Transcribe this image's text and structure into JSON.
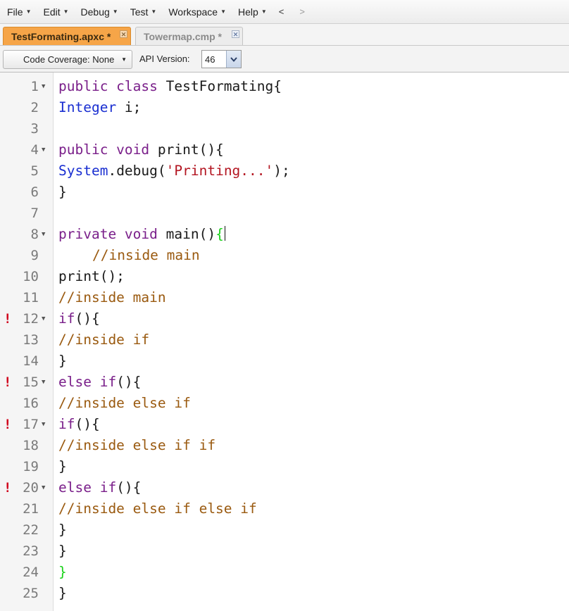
{
  "menubar": {
    "items": [
      {
        "label": "File"
      },
      {
        "label": "Edit"
      },
      {
        "label": "Debug"
      },
      {
        "label": "Test"
      },
      {
        "label": "Workspace"
      },
      {
        "label": "Help"
      }
    ],
    "back_label": "<",
    "forward_label": ">"
  },
  "tabs": [
    {
      "label": "TestFormating.apxc *",
      "active": true
    },
    {
      "label": "Towermap.cmp *",
      "active": false
    }
  ],
  "toolbar": {
    "coverage_label": "Code Coverage: None",
    "api_label": "API Version:",
    "api_value": "46"
  },
  "editor": {
    "lines": [
      {
        "num": "1",
        "fold": true,
        "error": false,
        "tokens": [
          {
            "t": "public class",
            "c": "kw"
          },
          {
            "t": " TestFormating{",
            "c": "plain"
          }
        ]
      },
      {
        "num": "2",
        "fold": false,
        "error": false,
        "tokens": [
          {
            "t": "Integer",
            "c": "type"
          },
          {
            "t": " i;",
            "c": "plain"
          }
        ]
      },
      {
        "num": "3",
        "fold": false,
        "error": false,
        "tokens": []
      },
      {
        "num": "4",
        "fold": true,
        "error": false,
        "tokens": [
          {
            "t": "public void",
            "c": "kw"
          },
          {
            "t": " print(){",
            "c": "plain"
          }
        ]
      },
      {
        "num": "5",
        "fold": false,
        "error": false,
        "tokens": [
          {
            "t": "System",
            "c": "type"
          },
          {
            "t": ".debug(",
            "c": "plain"
          },
          {
            "t": "'Printing...'",
            "c": "str"
          },
          {
            "t": ");",
            "c": "plain"
          }
        ]
      },
      {
        "num": "6",
        "fold": false,
        "error": false,
        "tokens": [
          {
            "t": "}",
            "c": "plain"
          }
        ]
      },
      {
        "num": "7",
        "fold": false,
        "error": false,
        "tokens": []
      },
      {
        "num": "8",
        "fold": true,
        "error": false,
        "cursor": true,
        "tokens": [
          {
            "t": "private void",
            "c": "kw"
          },
          {
            "t": " main()",
            "c": "plain"
          },
          {
            "t": "{",
            "c": "match"
          }
        ]
      },
      {
        "num": "9",
        "fold": false,
        "error": false,
        "indent": true,
        "tokens": [
          {
            "t": "//inside main",
            "c": "comment"
          }
        ]
      },
      {
        "num": "10",
        "fold": false,
        "error": false,
        "tokens": [
          {
            "t": "print();",
            "c": "plain"
          }
        ]
      },
      {
        "num": "11",
        "fold": false,
        "error": false,
        "tokens": [
          {
            "t": "//inside main",
            "c": "comment"
          }
        ]
      },
      {
        "num": "12",
        "fold": true,
        "error": true,
        "tokens": [
          {
            "t": "if",
            "c": "kw"
          },
          {
            "t": "(){",
            "c": "plain"
          }
        ]
      },
      {
        "num": "13",
        "fold": false,
        "error": false,
        "tokens": [
          {
            "t": "//inside if",
            "c": "comment"
          }
        ]
      },
      {
        "num": "14",
        "fold": false,
        "error": false,
        "tokens": [
          {
            "t": "}",
            "c": "plain"
          }
        ]
      },
      {
        "num": "15",
        "fold": true,
        "error": true,
        "tokens": [
          {
            "t": "else if",
            "c": "kw"
          },
          {
            "t": "(){",
            "c": "plain"
          }
        ]
      },
      {
        "num": "16",
        "fold": false,
        "error": false,
        "tokens": [
          {
            "t": "//inside else if",
            "c": "comment"
          }
        ]
      },
      {
        "num": "17",
        "fold": true,
        "error": true,
        "tokens": [
          {
            "t": "if",
            "c": "kw"
          },
          {
            "t": "(){",
            "c": "plain"
          }
        ]
      },
      {
        "num": "18",
        "fold": false,
        "error": false,
        "tokens": [
          {
            "t": "//inside else if if",
            "c": "comment"
          }
        ]
      },
      {
        "num": "19",
        "fold": false,
        "error": false,
        "tokens": [
          {
            "t": "}",
            "c": "plain"
          }
        ]
      },
      {
        "num": "20",
        "fold": true,
        "error": true,
        "tokens": [
          {
            "t": "else if",
            "c": "kw"
          },
          {
            "t": "(){",
            "c": "plain"
          }
        ]
      },
      {
        "num": "21",
        "fold": false,
        "error": false,
        "tokens": [
          {
            "t": "//inside else if else if",
            "c": "comment"
          }
        ]
      },
      {
        "num": "22",
        "fold": false,
        "error": false,
        "tokens": [
          {
            "t": "}",
            "c": "plain"
          }
        ]
      },
      {
        "num": "23",
        "fold": false,
        "error": false,
        "tokens": [
          {
            "t": "}",
            "c": "plain"
          }
        ]
      },
      {
        "num": "24",
        "fold": false,
        "error": false,
        "tokens": [
          {
            "t": "}",
            "c": "match"
          }
        ]
      },
      {
        "num": "25",
        "fold": false,
        "error": false,
        "tokens": [
          {
            "t": "}",
            "c": "plain"
          }
        ]
      }
    ],
    "error_marker": "!",
    "fold_glyph": "▼"
  },
  "colors": {
    "kw": "#7a1f8a",
    "type": "#1a2fd1",
    "plain": "#1a1a1a",
    "str": "#b31521",
    "comment": "#9a5a10",
    "match": "#19d219",
    "active_tab": "#f6a548"
  }
}
